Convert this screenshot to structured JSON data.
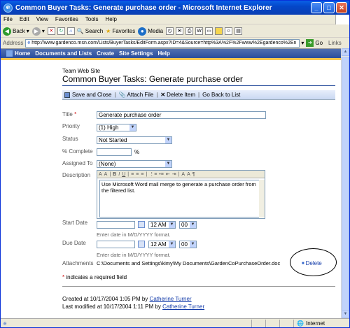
{
  "window": {
    "title": "Common Buyer Tasks: Generate purchase order - Microsoft Internet Explorer",
    "min": "_",
    "max": "□",
    "close": "✕"
  },
  "menu": [
    "File",
    "Edit",
    "View",
    "Favorites",
    "Tools",
    "Help"
  ],
  "toolbar": {
    "back": "Back",
    "search": "Search",
    "favorites": "Favorites",
    "media": "Media"
  },
  "address": {
    "label": "Address",
    "url": "http://www.gardenco.msn.com/Lists/BuyerTasks/EditForm.aspx?ID=4&Source=http%3A%2F%2Fwww%2Egardenco%2En",
    "go": "Go",
    "links": "Links"
  },
  "nav": [
    "Home",
    "Documents and Lists",
    "Create",
    "Site Settings",
    "Help"
  ],
  "page": {
    "site": "Team Web Site",
    "title": "Common Buyer Tasks: Generate purchase order"
  },
  "actions": [
    "Save and Close",
    "Attach File",
    "Delete Item",
    "Go Back to List"
  ],
  "form": {
    "title_label": "Title",
    "title_value": "Generate purchase order",
    "priority_label": "Priority",
    "priority_value": "(1) High",
    "status_label": "Status",
    "status_value": "Not Started",
    "complete_label": "% Complete",
    "complete_value": "",
    "percent": "%",
    "assigned_label": "Assigned To",
    "assigned_value": "(None)",
    "desc_label": "Description",
    "desc_value": "Use Microsoft Word mail merge to generate a purchase order from the filtered list.",
    "start_label": "Start Date",
    "due_label": "Due Date",
    "hour_value": "12 AM",
    "min_value": "00",
    "date_hint": "Enter date in M/D/YYYY format.",
    "attach_label": "Attachments",
    "attach_path": "C:\\Documents and Settings\\kimy\\My Documents\\GardenCoPurchaseOrder.doc",
    "delete": "Delete",
    "required_note": "indicates a required field",
    "req_mark": "*"
  },
  "footer": {
    "created": "Created at 10/17/2004 1:05 PM by",
    "modified": "Last modified at 10/17/2004 1:11 PM by",
    "user": "Catherine Turner"
  },
  "statusbar": {
    "zone": "Internet"
  }
}
